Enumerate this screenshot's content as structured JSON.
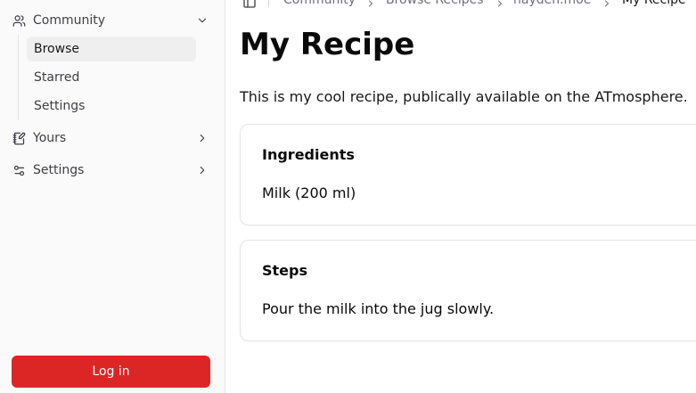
{
  "sidebar": {
    "community": {
      "label": "Community",
      "icon": "users-icon",
      "expanded": true
    },
    "community_items": [
      {
        "label": "Browse",
        "active": true
      },
      {
        "label": "Starred",
        "active": false
      },
      {
        "label": "Settings",
        "active": false
      }
    ],
    "yours": {
      "label": "Yours",
      "icon": "notebook-pen-icon"
    },
    "settings": {
      "label": "Settings",
      "icon": "sliders-icon"
    },
    "login_label": "Log in"
  },
  "breadcrumb": {
    "items": [
      "Community",
      "Browse Recipes",
      "hayden.moe"
    ],
    "current": "My Recipe"
  },
  "recipe": {
    "title": "My Recipe",
    "description": "This is my cool recipe, publically available on the ATmosphere.",
    "ingredients_heading": "Ingredients",
    "ingredients": [
      "Milk (200 ml)"
    ],
    "steps_heading": "Steps",
    "steps": [
      "Pour the milk into the jug slowly."
    ]
  },
  "colors": {
    "accent": "#dc2626",
    "sidebar_bg": "#fafafa",
    "active_item_bg": "#efefef",
    "border": "#e5e5e5"
  }
}
